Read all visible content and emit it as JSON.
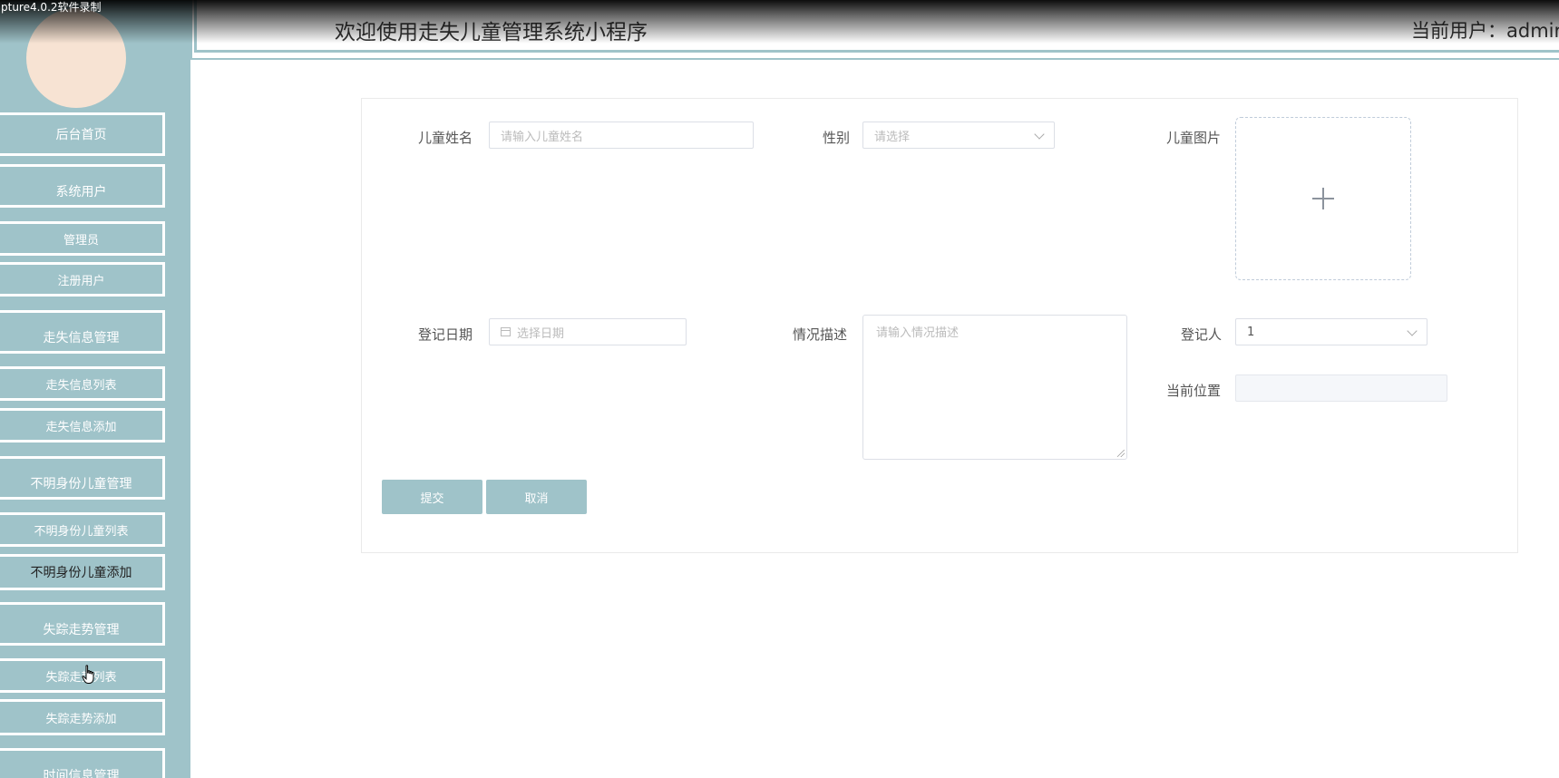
{
  "recorder": {
    "label": "pture4.0.2软件录制"
  },
  "header": {
    "title": "欢迎使用走失儿童管理系统小程序",
    "current_user": "当前用户：admin"
  },
  "sidebar": {
    "items": [
      {
        "label": "后台首页"
      },
      {
        "label": "系统用户"
      },
      {
        "label": "管理员"
      },
      {
        "label": "注册用户"
      },
      {
        "label": "走失信息管理"
      },
      {
        "label": "走失信息列表"
      },
      {
        "label": "走失信息添加"
      },
      {
        "label": "不明身份儿童管理"
      },
      {
        "label": "不明身份儿童列表"
      },
      {
        "label": "不明身份儿童添加"
      },
      {
        "label": "失踪走势管理"
      },
      {
        "label": "失踪走势列表"
      },
      {
        "label": "失踪走势添加"
      },
      {
        "label": "时间信息管理"
      }
    ]
  },
  "form": {
    "child_name": {
      "label": "儿童姓名",
      "placeholder": "请输入儿童姓名"
    },
    "gender": {
      "label": "性别",
      "placeholder": "请选择"
    },
    "child_image": {
      "label": "儿童图片"
    },
    "register_date": {
      "label": "登记日期",
      "placeholder": "选择日期"
    },
    "description": {
      "label": "情况描述",
      "placeholder": "请输入情况描述"
    },
    "registrant": {
      "label": "登记人",
      "value": "1"
    },
    "current_location": {
      "label": "当前位置",
      "value": ""
    },
    "submit_label": "提交",
    "cancel_label": "取消"
  },
  "colors": {
    "sidebar_bg": "#9fc3c9",
    "avatar": "#f7e3d3",
    "button": "#9fc3c9"
  }
}
